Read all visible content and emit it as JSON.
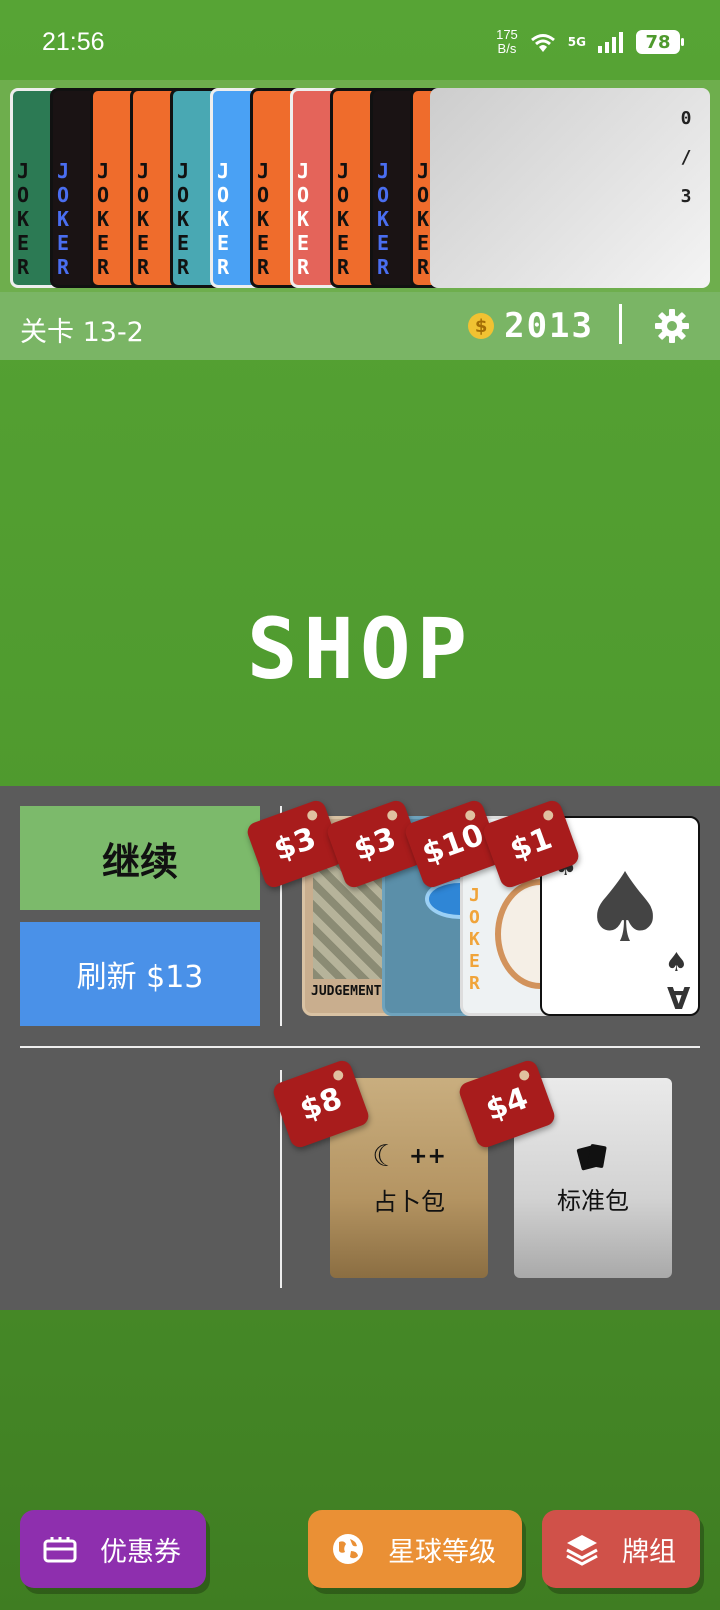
{
  "status_bar": {
    "time": "21:56",
    "net_speed_top": "175",
    "net_speed_bottom": "B/s",
    "network": "5G",
    "battery": "78"
  },
  "jokers": {
    "card_letters": [
      "J",
      "O",
      "K",
      "E",
      "R"
    ],
    "count_current": "0",
    "count_sep": "/",
    "count_max": "3"
  },
  "topbar": {
    "stage": "关卡 13-2",
    "money": "2013",
    "coin_symbol": "$"
  },
  "shop": {
    "title": "SHOP",
    "continue_label": "继续",
    "refresh_label": "刷新 $13",
    "items": [
      {
        "name": "card-judgement",
        "price": "$3",
        "caption": "JUDGEMENT"
      },
      {
        "name": "card-planet",
        "price": "$3"
      },
      {
        "name": "card-joker-mirror",
        "price": "$10"
      },
      {
        "name": "card-ace-spades",
        "price": "$1",
        "rank": "A",
        "suit": "♠"
      }
    ],
    "packs": [
      {
        "price": "$8",
        "name": "占卜包",
        "mark": "++"
      },
      {
        "price": "$4",
        "name": "标准包"
      }
    ]
  },
  "bottom": {
    "coupon": "优惠券",
    "planet_level": "星球等级",
    "deck": "牌组"
  },
  "colors": {
    "bg": "#4f9a2e",
    "panel": "#5b5b5b",
    "continue": "#7cba6b",
    "refresh": "#4a91e8",
    "price_tag": "#a81c1c",
    "coupon_btn": "#8e2fae",
    "planet_btn": "#ea9035",
    "deck_btn": "#d05149"
  }
}
